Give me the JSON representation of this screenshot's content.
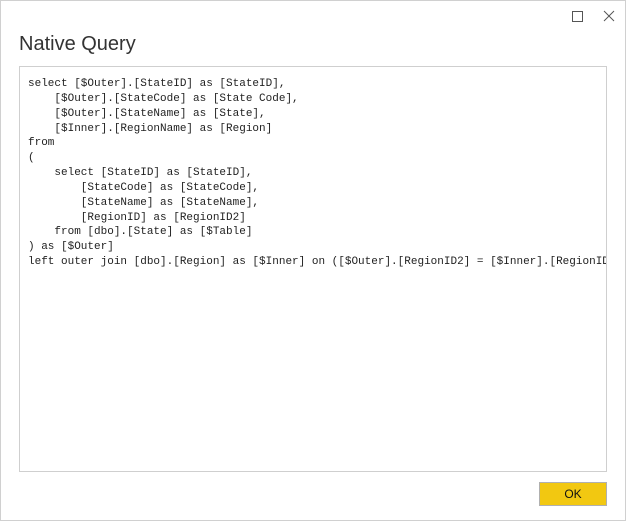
{
  "titlebar": {
    "maximize_tooltip": "Maximize",
    "close_tooltip": "Close"
  },
  "dialog": {
    "title": "Native Query",
    "query_text": "select [$Outer].[StateID] as [StateID],\n    [$Outer].[StateCode] as [State Code],\n    [$Outer].[StateName] as [State],\n    [$Inner].[RegionName] as [Region]\nfrom\n(\n    select [StateID] as [StateID],\n        [StateCode] as [StateCode],\n        [StateName] as [StateName],\n        [RegionID] as [RegionID2]\n    from [dbo].[State] as [$Table]\n) as [$Outer]\nleft outer join [dbo].[Region] as [$Inner] on ([$Outer].[RegionID2] = [$Inner].[RegionID])"
  },
  "buttons": {
    "ok_label": "OK"
  }
}
